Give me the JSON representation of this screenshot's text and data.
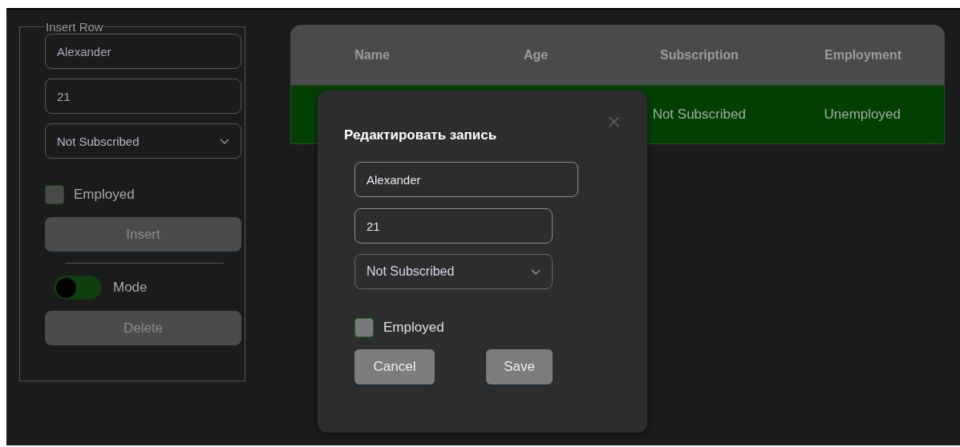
{
  "insert_form": {
    "legend": "Insert Row",
    "name_value": "Alexander",
    "age_value": "21",
    "subscription_value": "Not Subscribed",
    "employed": {
      "label": "Employed",
      "checked": false
    },
    "insert_button": "Insert",
    "mode": {
      "label": "Mode",
      "on": false
    },
    "delete_button": "Delete"
  },
  "table": {
    "columns": [
      "Name",
      "Age",
      "Subscription",
      "Employment"
    ],
    "rows": [
      {
        "cells": [
          "",
          "",
          "Not Subscribed",
          "Unemployed"
        ],
        "selected": true
      }
    ]
  },
  "dialog": {
    "title": "Редактировать запись",
    "close": "×",
    "name_value": "Alexander",
    "age_value": "21",
    "subscription_value": "Not Subscribed",
    "employed": {
      "label": "Employed",
      "checked": false
    },
    "buttons": [
      "Cancel",
      "Save"
    ]
  }
}
